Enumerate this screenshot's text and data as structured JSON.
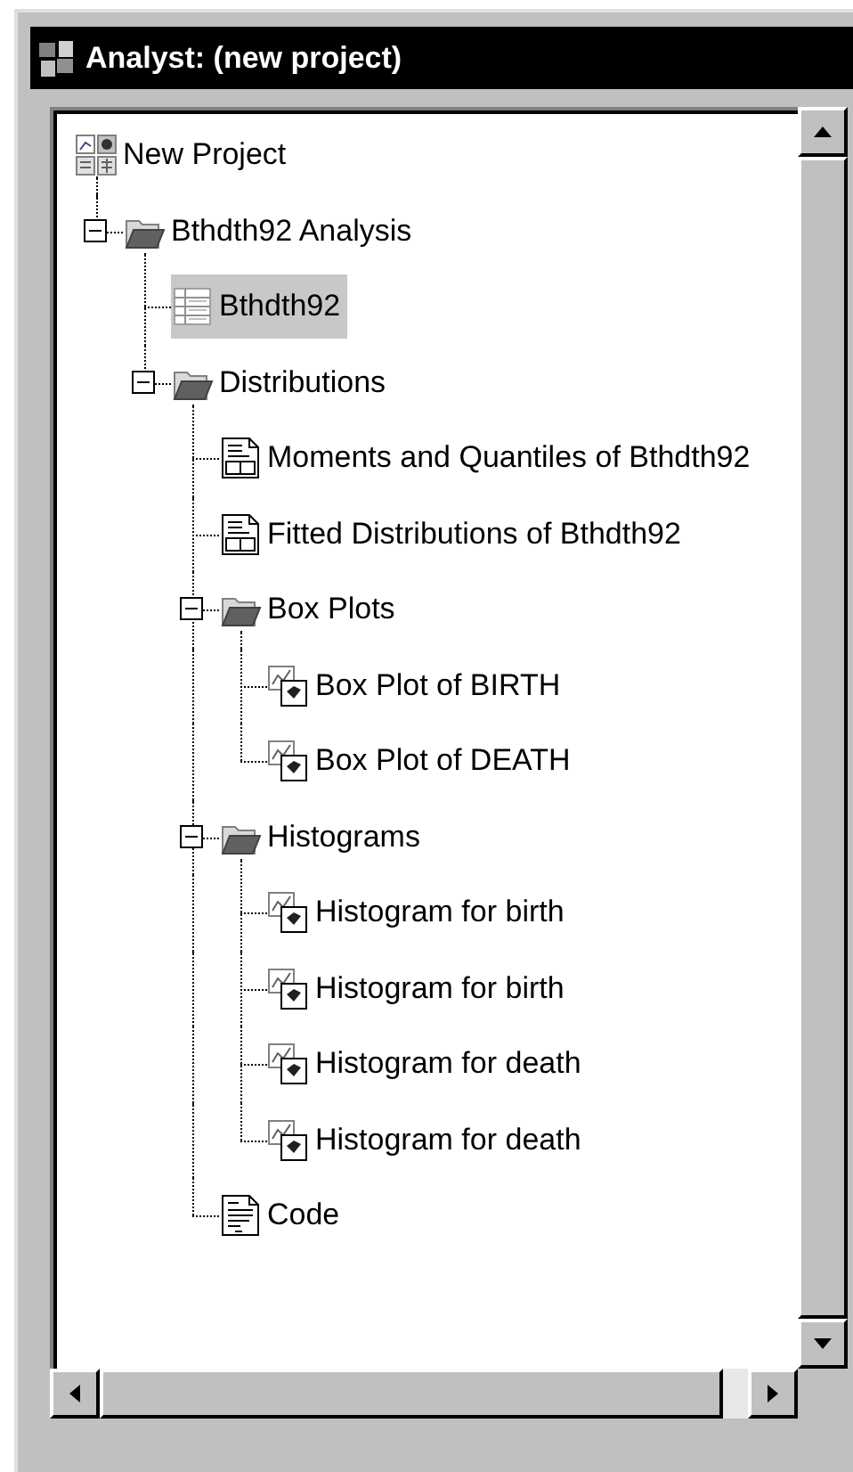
{
  "window": {
    "title": "Analyst: (new project)"
  },
  "tree": [
    {
      "label": "New Project",
      "kind": "project",
      "selected": false,
      "children": [
        {
          "label": "Bthdth92 Analysis",
          "kind": "folder",
          "selected": false,
          "expanded": true,
          "children": [
            {
              "label": "Bthdth92",
              "kind": "table",
              "selected": true
            },
            {
              "label": "Distributions",
              "kind": "folder",
              "selected": false,
              "expanded": true,
              "children": [
                {
                  "label": "Moments and Quantiles of Bthdth92",
                  "kind": "report",
                  "selected": false
                },
                {
                  "label": "Fitted Distributions of Bthdth92",
                  "kind": "report",
                  "selected": false
                },
                {
                  "label": "Box Plots",
                  "kind": "folder",
                  "selected": false,
                  "expanded": true,
                  "children": [
                    {
                      "label": "Box Plot of BIRTH",
                      "kind": "graph",
                      "selected": false
                    },
                    {
                      "label": "Box Plot of DEATH",
                      "kind": "graph",
                      "selected": false
                    }
                  ]
                },
                {
                  "label": "Histograms",
                  "kind": "folder",
                  "selected": false,
                  "expanded": true,
                  "children": [
                    {
                      "label": "Histogram for birth",
                      "kind": "graph",
                      "selected": false
                    },
                    {
                      "label": "Histogram for birth",
                      "kind": "graph",
                      "selected": false
                    },
                    {
                      "label": "Histogram for death",
                      "kind": "graph",
                      "selected": false
                    },
                    {
                      "label": "Histogram for death",
                      "kind": "graph",
                      "selected": false
                    }
                  ]
                },
                {
                  "label": "Code",
                  "kind": "code",
                  "selected": false
                }
              ]
            }
          ]
        }
      ]
    }
  ]
}
